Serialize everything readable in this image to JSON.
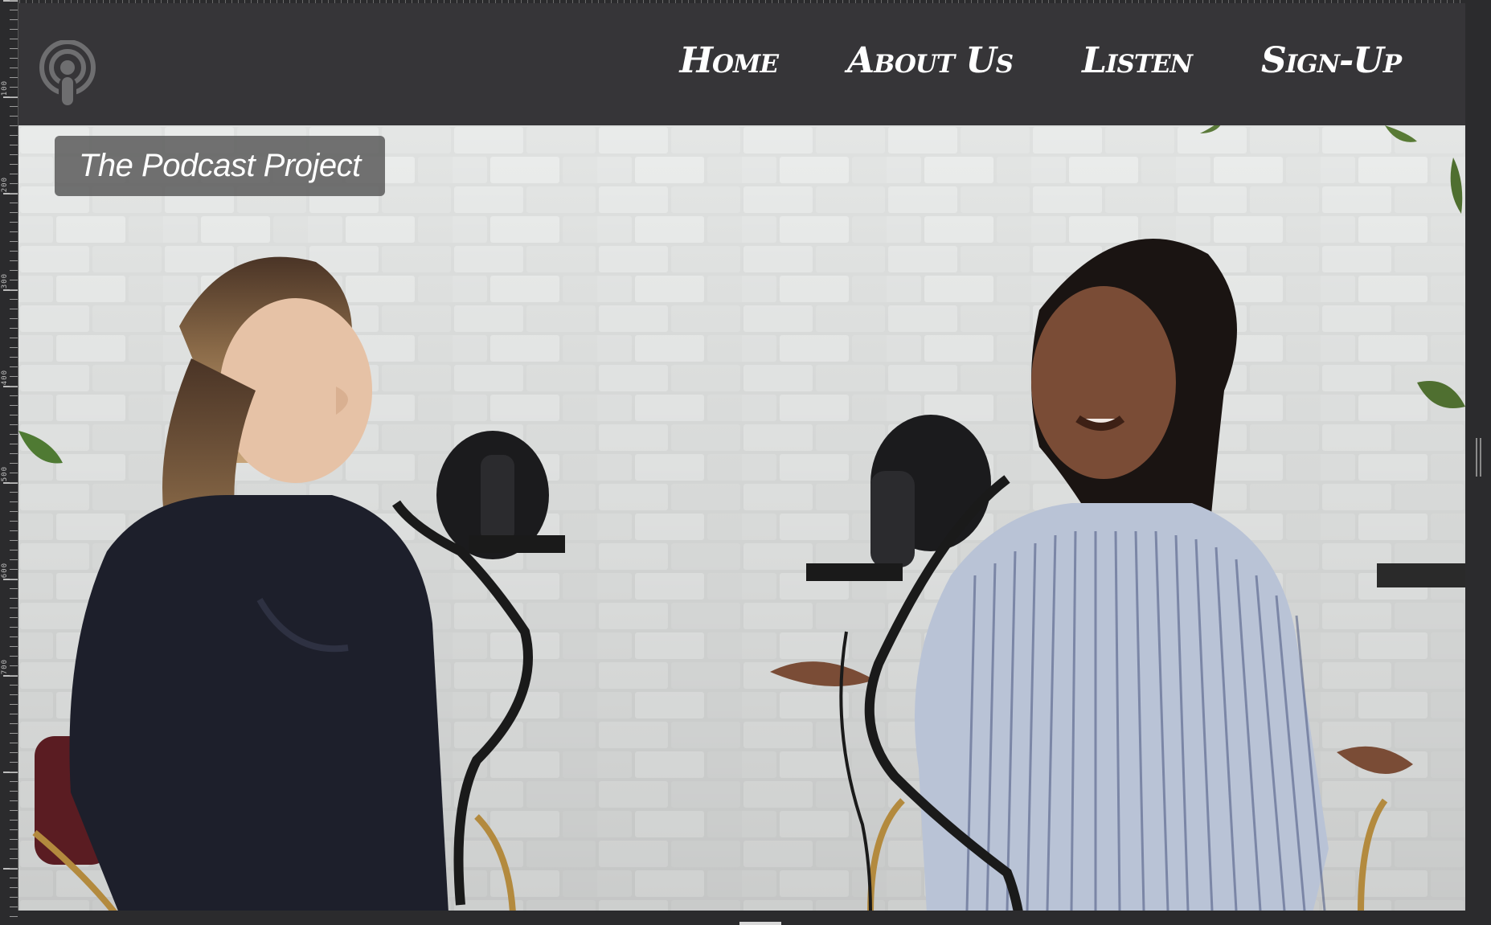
{
  "site": {
    "title_badge": "The Podcast Project",
    "logo_icon": "podcast-icon"
  },
  "nav": {
    "items": [
      {
        "label": "Home"
      },
      {
        "label": "About Us"
      },
      {
        "label": "Listen"
      },
      {
        "label": "Sign-Up"
      }
    ]
  },
  "hero": {
    "image_subject": "two women recording a podcast at microphones in front of a white brick wall"
  },
  "editor": {
    "ruler_marks": [
      "100",
      "200",
      "300",
      "400",
      "500",
      "600",
      "700"
    ]
  },
  "colors": {
    "navbar_bg": "#363538",
    "nav_text": "#ffffff",
    "badge_bg": "#5f5f5f",
    "logo_grey": "#6e6e70"
  }
}
